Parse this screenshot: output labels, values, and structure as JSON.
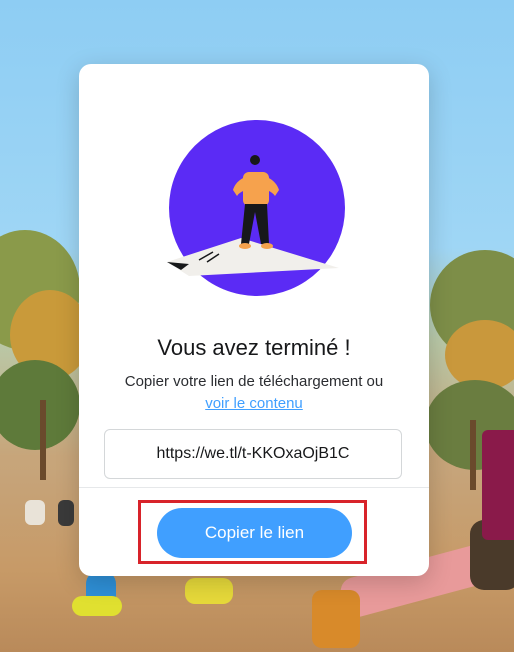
{
  "modal": {
    "title": "Vous avez terminé !",
    "description": "Copier votre lien de téléchargement ou",
    "view_link": "voir le contenu",
    "url": "https://we.tl/t-KKOxaOjB1C",
    "copy_button": "Copier le lien"
  },
  "colors": {
    "accent": "#409fff",
    "illustration_circle": "#5b2bf5",
    "highlight_border": "#d8232a"
  },
  "icons": {
    "illustration": "person-on-paper-illustration"
  }
}
